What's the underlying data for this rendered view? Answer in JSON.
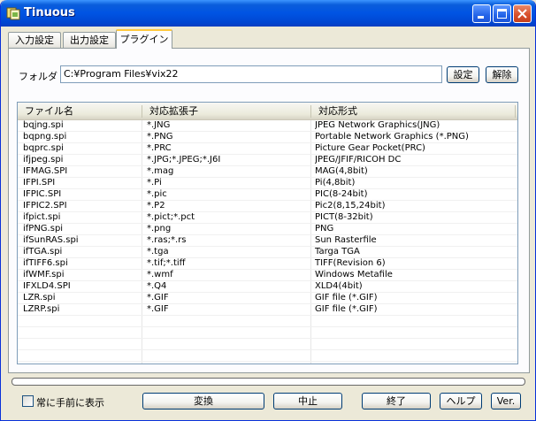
{
  "window": {
    "title": "Tinuous"
  },
  "tabs": [
    {
      "label": "入力設定"
    },
    {
      "label": "出力設定"
    },
    {
      "label": "プラグイン"
    }
  ],
  "folder": {
    "label": "フォルダ",
    "path": "C:¥Program Files¥vix22",
    "set_label": "設定",
    "clear_label": "解除"
  },
  "table": {
    "columns": [
      "ファイル名",
      "対応拡張子",
      "対応形式"
    ],
    "rows": [
      [
        "bqjng.spi",
        "*.JNG",
        "JPEG Network Graphics(JNG)"
      ],
      [
        "bqpng.spi",
        "*.PNG",
        "Portable Network Graphics (*.PNG)"
      ],
      [
        "bqprc.spi",
        "*.PRC",
        "Picture Gear Pocket(PRC)"
      ],
      [
        "ifjpeg.spi",
        "*.JPG;*.JPEG;*.J6I",
        "JPEG/JFIF/RICOH DC"
      ],
      [
        "IFMAG.SPI",
        "*.mag",
        "MAG(4,8bit)"
      ],
      [
        "IFPI.SPI",
        "*.Pi",
        "Pi(4,8bit)"
      ],
      [
        "IFPIC.SPI",
        "*.pic",
        "PIC(8-24bit)"
      ],
      [
        "IFPIC2.SPI",
        "*.P2",
        "Pic2(8,15,24bit)"
      ],
      [
        "ifpict.spi",
        "*.pict;*.pct",
        "PICT(8-32bit)"
      ],
      [
        "ifPNG.spi",
        "*.png",
        "PNG"
      ],
      [
        "ifSunRAS.spi",
        "*.ras;*.rs",
        "Sun Rasterfile"
      ],
      [
        "ifTGA.spi",
        "*.tga",
        "Targa TGA"
      ],
      [
        "ifTIFF6.spi",
        "*.tif;*.tiff",
        "TIFF(Revision 6)"
      ],
      [
        "ifWMF.spi",
        "*.wmf",
        "Windows Metafile"
      ],
      [
        "IFXLD4.SPI",
        "*.Q4",
        "XLD4(4bit)"
      ],
      [
        "LZR.spi",
        "*.GIF",
        "GIF file (*.GIF)"
      ],
      [
        "LZRP.spi",
        "*.GIF",
        "GIF file (*.GIF)"
      ]
    ]
  },
  "bottom": {
    "topmost_label": "常に手前に表示",
    "topmost_checked": false,
    "convert_label": "変換",
    "stop_label": "中止",
    "exit_label": "終了",
    "help_label": "ヘルプ",
    "version_label": "Ver.",
    "progress_fraction": 0.0
  },
  "colors": {
    "titlebar": "#0054e3",
    "tab_highlight": "#ffc83c",
    "dialog_bg": "#ece9d8"
  }
}
